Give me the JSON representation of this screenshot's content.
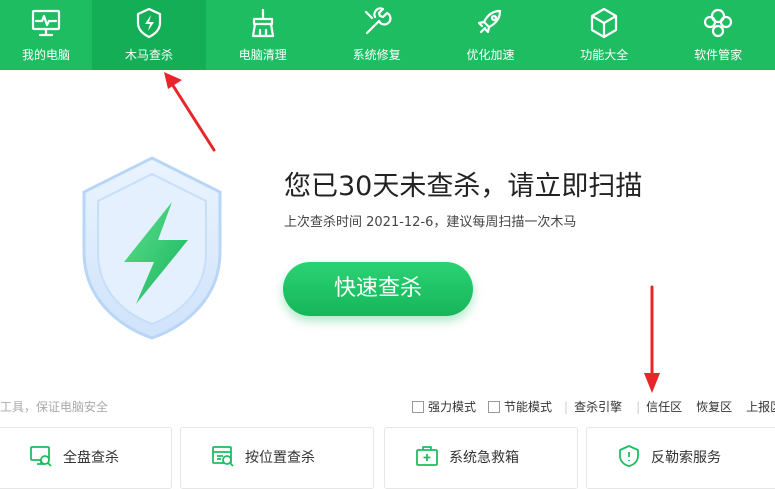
{
  "nav": {
    "items": [
      {
        "label": "我的电脑",
        "icon": "monitor-pulse-icon"
      },
      {
        "label": "木马查杀",
        "icon": "shield-bolt-icon"
      },
      {
        "label": "电脑清理",
        "icon": "broom-clean-icon"
      },
      {
        "label": "系统修复",
        "icon": "wrench-icon"
      },
      {
        "label": "优化加速",
        "icon": "rocket-icon"
      },
      {
        "label": "功能大全",
        "icon": "cube-icon"
      },
      {
        "label": "软件管家",
        "icon": "apps-grid-icon"
      }
    ],
    "active_index": 1
  },
  "hero": {
    "headline": "您已30天未查杀，请立即扫描",
    "subline": "上次查杀时间 2021-12-6，建议每周扫描一次木马",
    "button": "快速查杀"
  },
  "options": {
    "slogan": "工具，保证电脑安全",
    "power_mode": "强力模式",
    "eco_mode": "节能模式",
    "engine": "查杀引擎",
    "trust_zone": "信任区",
    "restore_zone": "恢复区",
    "report_zone": "上报区"
  },
  "cards": [
    {
      "label": "全盘查杀",
      "icon": "full-scan-icon"
    },
    {
      "label": "按位置查杀",
      "icon": "location-scan-icon"
    },
    {
      "label": "系统急救箱",
      "icon": "first-aid-kit-icon"
    },
    {
      "label": "反勒索服务",
      "icon": "anti-ransom-shield-icon"
    }
  ],
  "colors": {
    "brand": "#1ebd62",
    "nav_active": "#14ae57",
    "annotation_arrow": "#e8262a"
  }
}
